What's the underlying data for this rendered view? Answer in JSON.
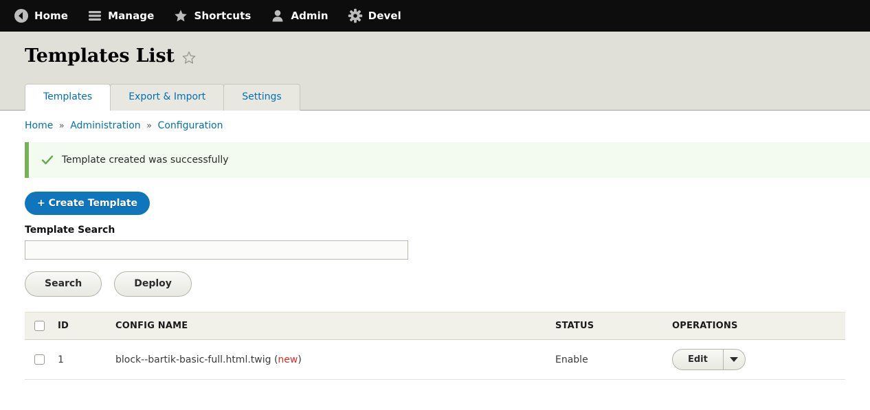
{
  "toolbar": {
    "items": [
      {
        "label": "Home",
        "icon": "back-arrow-circle-icon"
      },
      {
        "label": "Manage",
        "icon": "hamburger-menu-icon"
      },
      {
        "label": "Shortcuts",
        "icon": "star-icon"
      },
      {
        "label": "Admin",
        "icon": "user-icon"
      },
      {
        "label": "Devel",
        "icon": "gear-icon"
      }
    ]
  },
  "header": {
    "title": "Templates List",
    "favorite_icon": "star-outline-icon"
  },
  "tabs": [
    {
      "label": "Templates",
      "active": true
    },
    {
      "label": "Export & Import",
      "active": false
    },
    {
      "label": "Settings",
      "active": false
    }
  ],
  "breadcrumb": {
    "items": [
      "Home",
      "Administration",
      "Configuration"
    ],
    "separator": "»"
  },
  "message": {
    "icon": "check-icon",
    "text": "Template created was successfully",
    "accent_color": "#77b259",
    "background_color": "#f3faef"
  },
  "actions": {
    "create_label": "+ Create Template",
    "create_color": "#1076bc"
  },
  "search_form": {
    "label": "Template Search",
    "value": "",
    "placeholder": "",
    "search_label": "Search",
    "deploy_label": "Deploy"
  },
  "table": {
    "columns": [
      "",
      "ID",
      "CONFIG NAME",
      "STATUS",
      "OPERATIONS"
    ],
    "select_all_checked": false,
    "rows": [
      {
        "checked": false,
        "id": "1",
        "config_name": "block--bartik-basic-full.html.twig",
        "flag_open": "(",
        "flag": "new",
        "flag_close": ")",
        "flag_color": "#e02b27",
        "status": "Enable",
        "operation_label": "Edit",
        "operation_toggle_icon": "chevron-down-icon"
      }
    ]
  }
}
